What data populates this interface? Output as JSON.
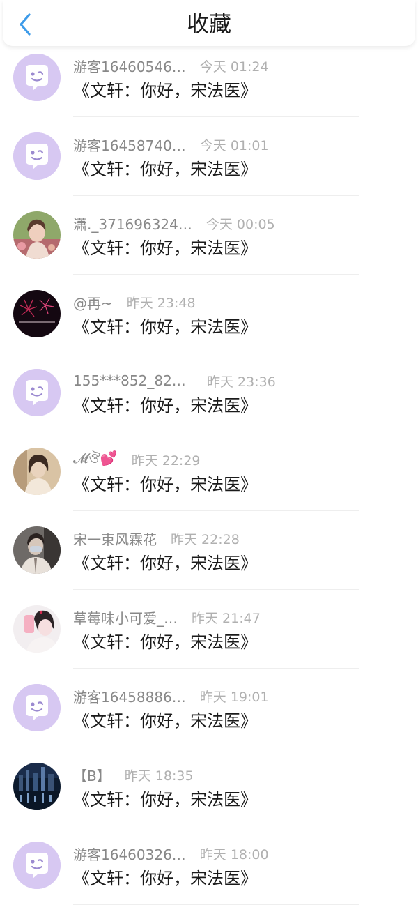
{
  "header": {
    "title": "收藏",
    "back_icon": "chevron-left-icon",
    "accent_color": "#3d9be9"
  },
  "items": [
    {
      "user": "游客16460546…",
      "time": "今天 01:24",
      "text": "《文轩：你好，宋法医》",
      "avatar": "default"
    },
    {
      "user": "游客16458740…",
      "time": "今天 01:01",
      "text": "《文轩：你好，宋法医》",
      "avatar": "default"
    },
    {
      "user": "潇._371696324…",
      "time": "今天 00:05",
      "text": "《文轩：你好，宋法医》",
      "avatar": "photo-girl-flowers"
    },
    {
      "user": "@再~",
      "time": "昨天 23:48",
      "text": "《文轩：你好，宋法医》",
      "avatar": "photo-fireworks"
    },
    {
      "user": "155***852_828…",
      "time": "昨天 23:36",
      "text": "《文轩：你好，宋法医》",
      "avatar": "default"
    },
    {
      "user": "𝓜ঔ💕",
      "time": "昨天 22:29",
      "text": "《文轩：你好，宋法医》",
      "avatar": "photo-girl-sepia"
    },
    {
      "user": "宋一束风霖花",
      "time": "昨天 22:28",
      "text": "《文轩：你好，宋法医》",
      "avatar": "photo-man-mask"
    },
    {
      "user": "草莓味小可爱_…",
      "time": "昨天 21:47",
      "text": "《文轩：你好，宋法医》",
      "avatar": "photo-girl-phone"
    },
    {
      "user": "游客16458886…",
      "time": "昨天 19:01",
      "text": "《文轩：你好，宋法医》",
      "avatar": "default"
    },
    {
      "user": "【B】",
      "time": "昨天 18:35",
      "text": "《文轩：你好，宋法医》",
      "avatar": "photo-city-night"
    },
    {
      "user": "游客16460326…",
      "time": "昨天 18:00",
      "text": "《文轩：你好，宋法医》",
      "avatar": "default"
    }
  ]
}
